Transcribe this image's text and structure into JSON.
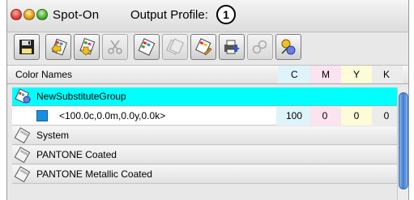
{
  "window": {
    "title": "Spot-On",
    "subtitle": "Output Profile:",
    "callout": "1"
  },
  "toolbar": {
    "buttons": [
      {
        "icon": "save-icon",
        "enabled": true
      },
      {
        "icon": "import-group-icon",
        "enabled": true
      },
      {
        "icon": "export-group-icon",
        "enabled": true
      },
      {
        "icon": "cut-icon",
        "enabled": false
      },
      {
        "icon": "new-group-icon",
        "enabled": true
      },
      {
        "icon": "duplicate-group-icon",
        "enabled": false
      },
      {
        "icon": "edit-group-icon",
        "enabled": true
      },
      {
        "icon": "print-group-icon",
        "enabled": true
      },
      {
        "icon": "link-icon",
        "enabled": false
      },
      {
        "icon": "substitute-icon",
        "enabled": true
      }
    ]
  },
  "columns": {
    "name": "Color Names",
    "c": "C",
    "m": "M",
    "y": "Y",
    "k": "K",
    "colors": {
      "c": "#dff3fb",
      "m": "#fbe3ef",
      "y": "#fdfbd8",
      "k": "#ececec"
    }
  },
  "rows": [
    {
      "label": "NewSubstituteGroup",
      "icon": "substitute-group-icon",
      "selected": true
    },
    {
      "label": "<100.0c,0.0m,0.0y,0.0k>",
      "swatch": "#1a8fe0",
      "c": "100",
      "m": "0",
      "y": "0",
      "k": "0"
    },
    {
      "label": "System",
      "icon": "color-book-icon"
    },
    {
      "label": "PANTONE Coated",
      "icon": "color-book-icon"
    },
    {
      "label": "PANTONE Metallic Coated",
      "icon": "color-book-icon"
    }
  ]
}
